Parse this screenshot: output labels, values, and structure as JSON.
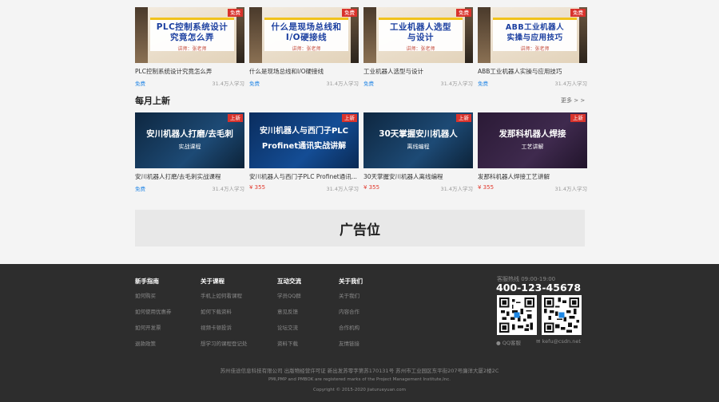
{
  "top_courses": [
    {
      "thumb_title": "PLC控制系统设计\n究竟怎么弄",
      "teacher": "讲师：张老师",
      "badge": "免费",
      "name": "PLC控制系统设计究竟怎么弄",
      "price": "免费",
      "learners": "31.4万人学习"
    },
    {
      "thumb_title": "什么是现场总线和\nI/O硬接线",
      "teacher": "讲师：张老师",
      "badge": "免费",
      "name": "什么是现场总线和I/O硬接线",
      "price": "免费",
      "learners": "31.4万人学习"
    },
    {
      "thumb_title": "工业机器人选型\n与设计",
      "teacher": "讲师：张老师",
      "badge": "免费",
      "name": "工业机器人选型与设计",
      "price": "免费",
      "learners": "31.4万人学习"
    },
    {
      "thumb_title": "ABB工业机器人\n实操与应用技巧",
      "teacher": "讲师：张老师",
      "badge": "免费",
      "name": "ABB工业机器人实操与应用技巧",
      "price": "免费",
      "learners": "31.4万人学习"
    }
  ],
  "monthly": {
    "title": "每月上新",
    "more": "更多 > >",
    "courses": [
      {
        "thumb_title": "安川机器人打磨/去毛刺",
        "thumb_sub": "实战课程",
        "badge": "上新",
        "name": "安川机器人打磨/去毛刺实战课程",
        "price": "免费",
        "learners": "31.4万人学习"
      },
      {
        "thumb_title": "安川机器人与西门子PLC\nProfinet通讯实战讲解",
        "thumb_sub": "",
        "badge": "上新",
        "name": "安川机器人与西门子PLC Profinet通讯...",
        "price": "¥ 355",
        "learners": "31.4万人学习"
      },
      {
        "thumb_title": "30天掌握安川机器人",
        "thumb_sub": "离线编程",
        "badge": "上新",
        "name": "30天掌握安川机器人离线编程",
        "price": "¥ 355",
        "learners": "31.4万人学习"
      },
      {
        "thumb_title": "发那科机器人焊接",
        "thumb_sub": "工艺讲解",
        "badge": "上新",
        "name": "发那科机器人焊接工艺讲解",
        "price": "¥ 355",
        "learners": "31.4万人学习"
      }
    ]
  },
  "ad": {
    "label": "广告位"
  },
  "footer": {
    "columns": [
      {
        "title": "新手指南",
        "links": [
          "如何购买",
          "如何使用优惠券",
          "如何开发票",
          "退款政策"
        ]
      },
      {
        "title": "关于课程",
        "links": [
          "手机上如何看课程",
          "如何下载资料",
          "视频卡顿投诉",
          "想学习的课程登记处"
        ]
      },
      {
        "title": "互动交流",
        "links": [
          "学员QQ群",
          "意见反馈",
          "论坛交流",
          "资料下载"
        ]
      },
      {
        "title": "关于我们",
        "links": [
          "关于我们",
          "内容合作",
          "合作机构",
          "友情链接"
        ]
      }
    ],
    "hotline_label": "客服热线 09:00-19:00",
    "phone": "400-123-45678",
    "qq_label": "QQ客服",
    "email": "kefu@csdn.net",
    "company": "苏州佳途信息科技有限公司 出版物经营许可证 新出发苏零字第苏170131号 苏州市工业园区东平街207号廉洋大厦2楼2C",
    "trademark": "PMI,PMP and PMBOK are registered marks of the Project Management Institute,Inc.",
    "copyright": "Copyright © 2015-2020 jiaturueyuan.com"
  }
}
